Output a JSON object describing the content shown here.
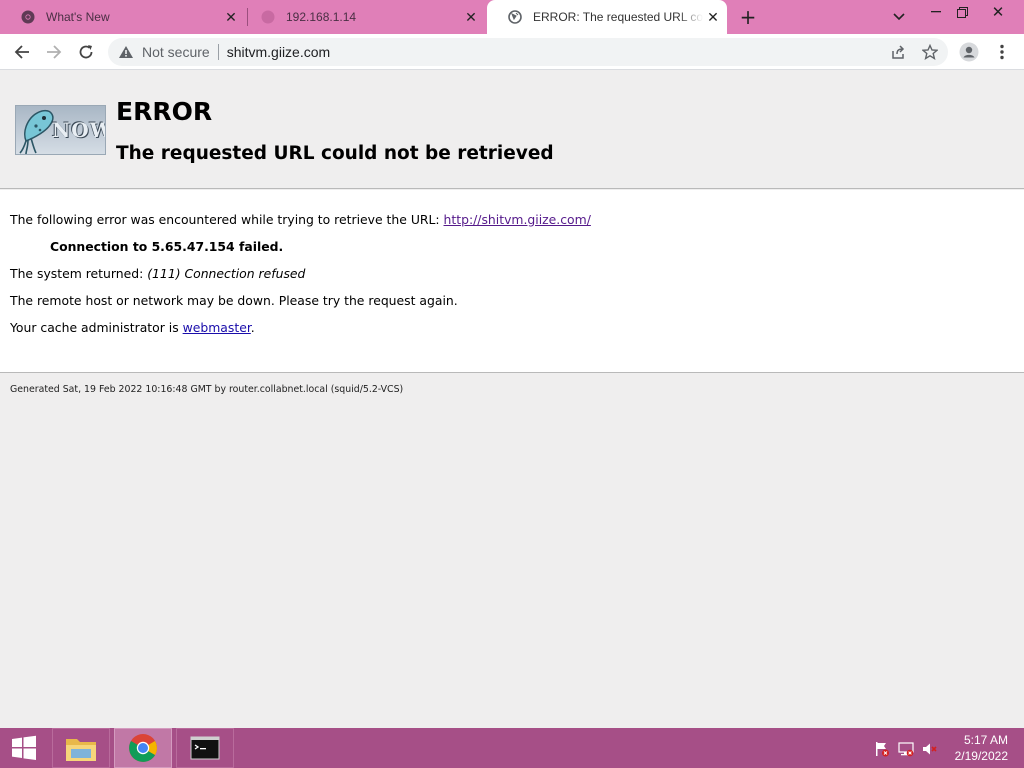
{
  "browser": {
    "tabs": [
      {
        "title": "What's New",
        "icon": "chrome-icon"
      },
      {
        "title": "192.168.1.14",
        "icon": "globe-icon"
      },
      {
        "title": "ERROR: The requested URL could not be retrieved",
        "icon": "globe-icon"
      }
    ],
    "address": {
      "security_label": "Not secure",
      "url": "shitvm.giize.com"
    }
  },
  "page": {
    "logo_text": "NOW",
    "title": "ERROR",
    "subtitle": "The requested URL could not be retrieved",
    "intro_text": "The following error was encountered while trying to retrieve the URL: ",
    "intro_link": "http://shitvm.giize.com/",
    "connection_failed": "Connection to 5.65.47.154 failed.",
    "system_returned_label": "The system returned: ",
    "system_returned_value": "(111) Connection refused",
    "remote_host_text": "The remote host or network may be down. Please try the request again.",
    "admin_text": "Your cache administrator is ",
    "admin_link": "webmaster",
    "admin_suffix": ".",
    "footer": "Generated Sat, 19 Feb 2022 10:16:48 GMT by router.collabnet.local (squid/5.2-VCS)"
  },
  "taskbar": {
    "time": "5:17 AM",
    "date": "2/19/2022"
  },
  "colors": {
    "tabstrip": "#e07fb8",
    "taskbar": "#a64f87",
    "link": "#1a0dab"
  }
}
